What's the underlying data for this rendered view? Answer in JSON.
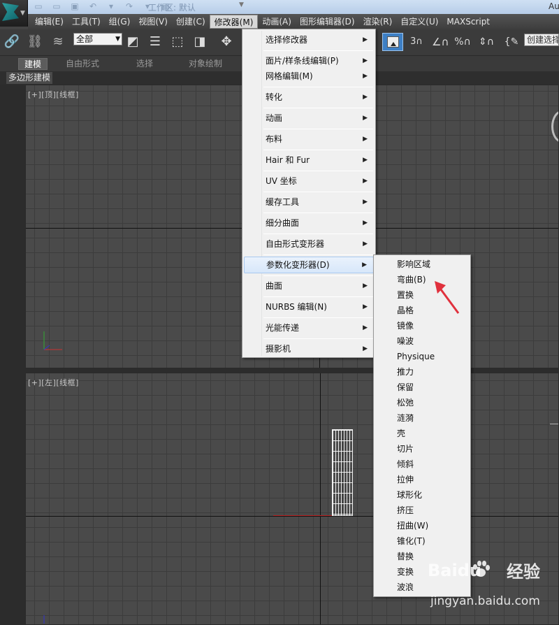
{
  "titlebar": {
    "workspace_label": "工作区: 默认",
    "right_text": "Au"
  },
  "menubar": {
    "items": [
      "编辑(E)",
      "工具(T)",
      "组(G)",
      "视图(V)",
      "创建(C)",
      "修改器(M)",
      "动画(A)",
      "图形编辑器(D)",
      "渲染(R)",
      "自定义(U)",
      "MAXScript"
    ]
  },
  "toolbar": {
    "selection_filter": "全部",
    "named_selection": "创建选择集"
  },
  "ribbon": {
    "tabs": [
      "建模",
      "自由形式",
      "选择",
      "对象绘制"
    ],
    "sub_tab": "多边形建模"
  },
  "viewports": {
    "top_label": "[+][顶][线框]",
    "left_label": "[+][左][线框]"
  },
  "modifiers_menu": {
    "items": [
      {
        "label": "选择修改器"
      },
      {
        "label": "面片/样条线编辑(P)"
      },
      {
        "label": "网格编辑(M)"
      },
      {
        "label": "转化"
      },
      {
        "label": "动画"
      },
      {
        "label": "布料"
      },
      {
        "label": "Hair 和 Fur"
      },
      {
        "label": "UV 坐标"
      },
      {
        "label": "缓存工具"
      },
      {
        "label": "细分曲面"
      },
      {
        "label": "自由形式变形器"
      },
      {
        "label": "参数化变形器(D)"
      },
      {
        "label": "曲面"
      },
      {
        "label": "NURBS 编辑(N)"
      },
      {
        "label": "光能传递"
      },
      {
        "label": "摄影机"
      }
    ],
    "highlighted": "参数化变形器(D)"
  },
  "param_deformers_menu": {
    "items": [
      "影响区域",
      "弯曲(B)",
      "置换",
      "晶格",
      "镜像",
      "噪波",
      "Physique",
      "推力",
      "保留",
      "松弛",
      "涟漪",
      "壳",
      "切片",
      "倾斜",
      "拉伸",
      "球形化",
      "挤压",
      "扭曲(W)",
      "锥化(T)",
      "替换",
      "变换",
      "波浪"
    ]
  },
  "watermark": {
    "brand": "Baidu",
    "brand_cn": "经验",
    "site": "jingyan.baidu.com"
  },
  "colors": {
    "annotation_arrow": "#e0313d",
    "menu_highlight": "#d7e7fa",
    "viewport_bg": "#4a4a4a"
  }
}
